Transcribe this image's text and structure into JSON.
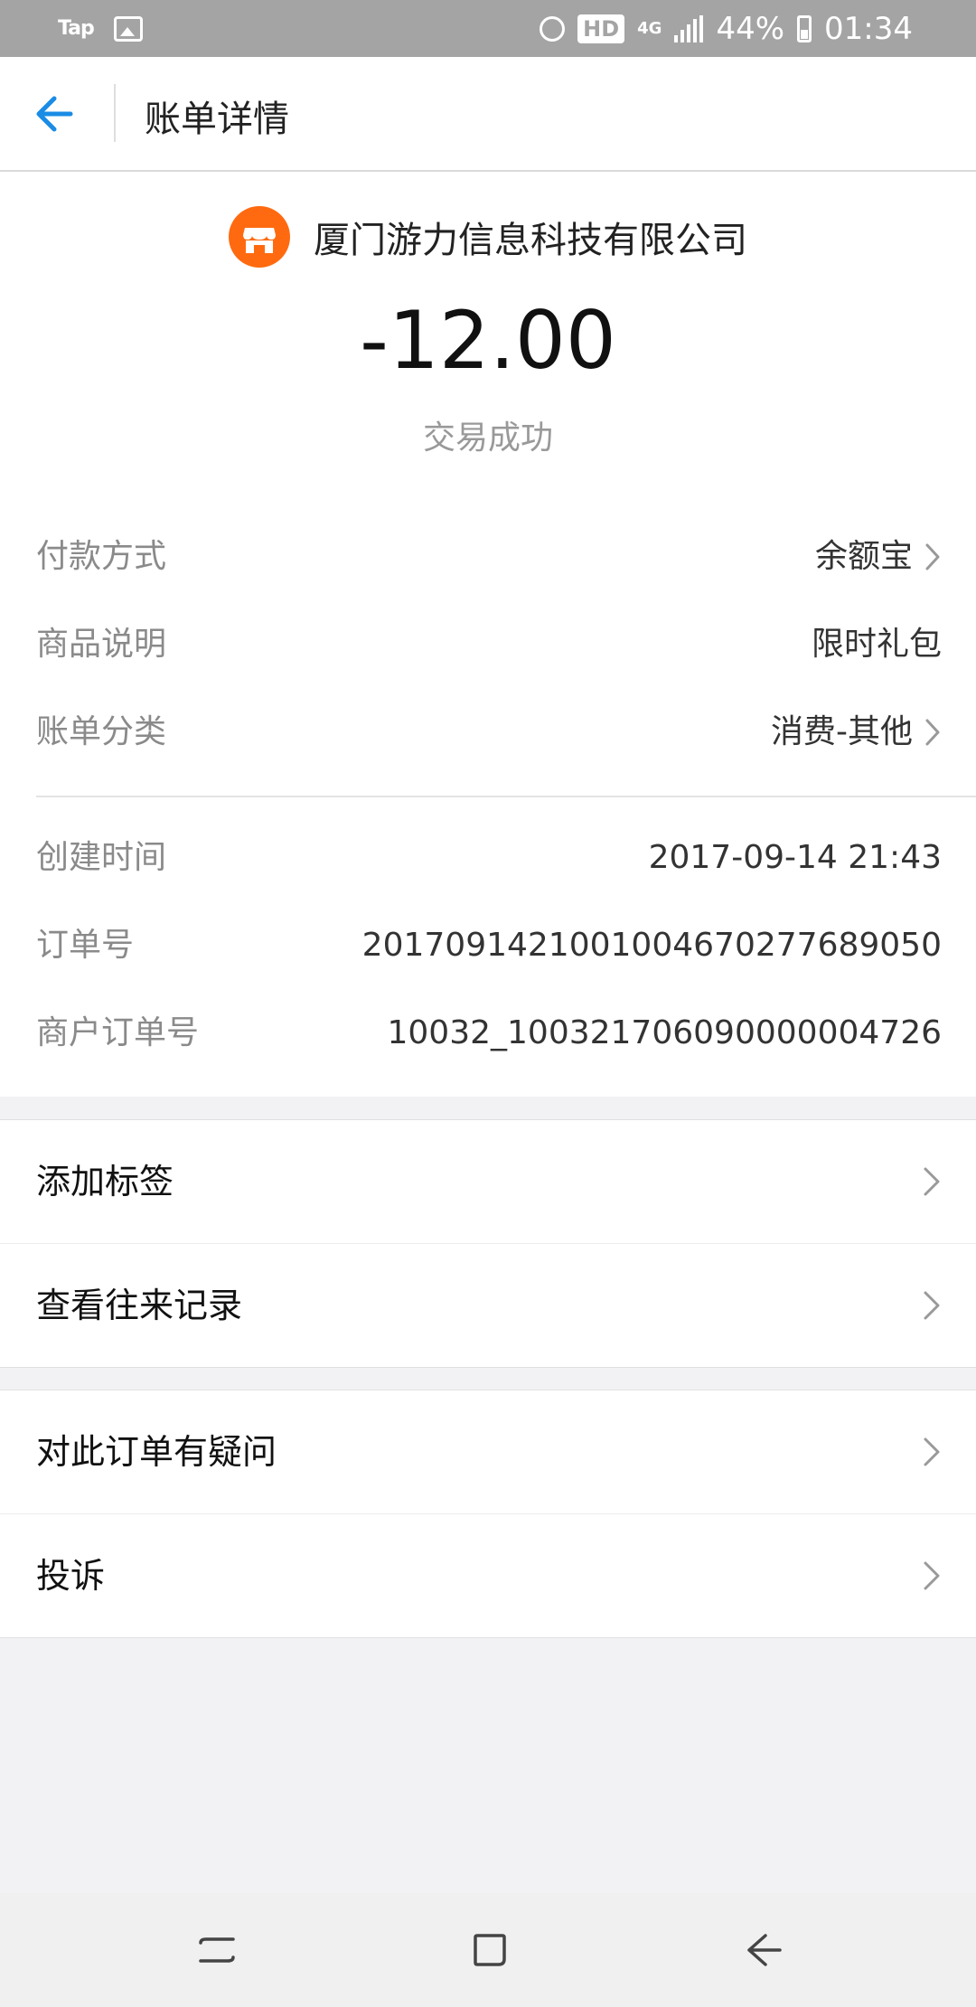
{
  "status_bar": {
    "left_label": "Tap",
    "hd_badge": "HD",
    "network": "4G",
    "battery": "44%",
    "time": "01:34"
  },
  "header": {
    "title": "账单详情"
  },
  "summary": {
    "merchant": "厦门游力信息科技有限公司",
    "amount": "-12.00",
    "status": "交易成功"
  },
  "details": {
    "payment_method": {
      "label": "付款方式",
      "value": "余额宝"
    },
    "product_desc": {
      "label": "商品说明",
      "value": "限时礼包"
    },
    "bill_category": {
      "label": "账单分类",
      "value": "消费-其他"
    },
    "created_time": {
      "label": "创建时间",
      "value": "2017-09-14 21:43"
    },
    "order_no": {
      "label": "订单号",
      "value": "2017091421001004670277689050"
    },
    "merchant_order_no": {
      "label": "商户订单号",
      "value": "10032_100321706090000004726"
    }
  },
  "actions": {
    "add_tag": "添加标签",
    "view_records": "查看往来记录",
    "question": "对此订单有疑问",
    "complain": "投诉"
  },
  "colors": {
    "accent": "#1a8ce5",
    "merchant_logo": "#ff6a10"
  }
}
